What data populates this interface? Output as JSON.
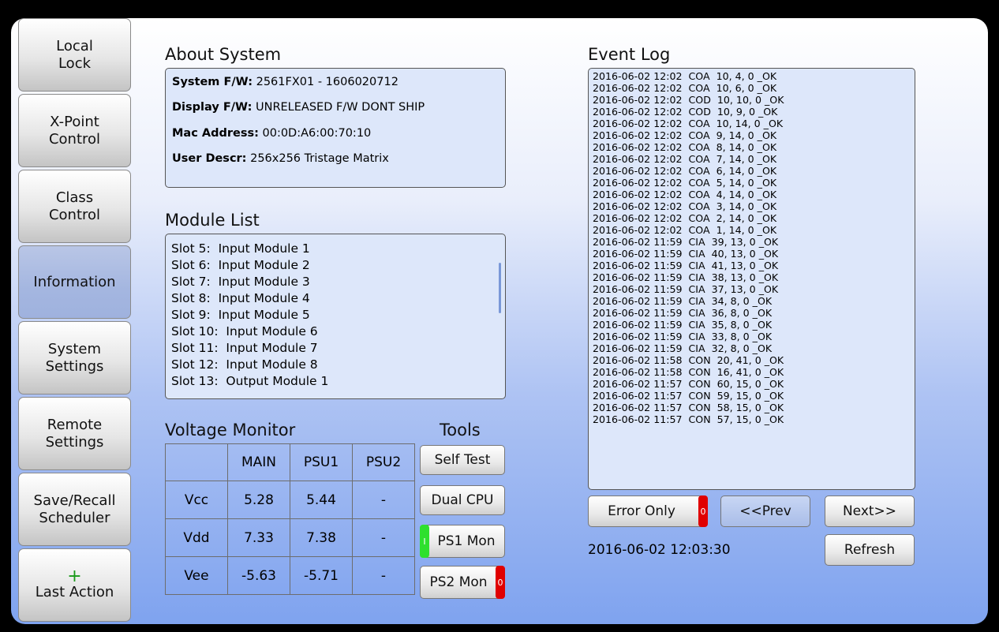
{
  "sidebar": {
    "items": [
      {
        "label": "Local\nLock"
      },
      {
        "label": "X-Point\nControl"
      },
      {
        "label": "Class\nControl"
      },
      {
        "label": "Information"
      },
      {
        "label": "System\nSettings"
      },
      {
        "label": "Remote\nSettings"
      },
      {
        "label": "Save/Recall\nScheduler"
      },
      {
        "label": "Last Action",
        "icon": "plus-icon",
        "glyph": "+"
      }
    ],
    "active": "Information"
  },
  "about": {
    "title": "About System",
    "system_fw_label": "System F/W:",
    "system_fw": "2561FX01 - 1606020712",
    "display_fw_label": "Display F/W:",
    "display_fw": "UNRELEASED F/W DONT SHIP",
    "mac_label": "Mac Address:",
    "mac": "00:0D:A6:00:70:10",
    "user_descr_label": "User Descr:",
    "user_descr": "256x256 Tristage Matrix"
  },
  "modules": {
    "title": "Module List",
    "items": [
      "Slot 5:  Input Module 1",
      "Slot 6:  Input Module 2",
      "Slot 7:  Input Module 3",
      "Slot 8:  Input Module 4",
      "Slot 9:  Input Module 5",
      "Slot 10:  Input Module 6",
      "Slot 11:  Input Module 7",
      "Slot 12:  Input Module 8",
      "Slot 13:  Output Module 1"
    ]
  },
  "voltage": {
    "title": "Voltage Monitor",
    "headers": [
      "",
      "MAIN",
      "PSU1",
      "PSU2"
    ],
    "rows": [
      [
        "Vcc",
        "5.28",
        "5.44",
        "-"
      ],
      [
        "Vdd",
        "7.33",
        "7.38",
        "-"
      ],
      [
        "Vee",
        "-5.63",
        "-5.71",
        "-"
      ]
    ]
  },
  "tools": {
    "title": "Tools",
    "self_test": "Self Test",
    "dual_cpu": "Dual CPU",
    "ps1_mon": "PS1 Mon",
    "ps1_indicator": "I",
    "ps2_mon": "PS2 Mon",
    "ps2_indicator": "0"
  },
  "event_log": {
    "title": "Event Log",
    "entries": [
      "2016-06-02 12:02  COA  10, 4, 0 _OK",
      "2016-06-02 12:02  COA  10, 6, 0 _OK",
      "2016-06-02 12:02  COD  10, 10, 0 _OK",
      "2016-06-02 12:02  COD  10, 9, 0 _OK",
      "2016-06-02 12:02  COA  10, 14, 0 _OK",
      "2016-06-02 12:02  COA  9, 14, 0 _OK",
      "2016-06-02 12:02  COA  8, 14, 0 _OK",
      "2016-06-02 12:02  COA  7, 14, 0 _OK",
      "2016-06-02 12:02  COA  6, 14, 0 _OK",
      "2016-06-02 12:02  COA  5, 14, 0 _OK",
      "2016-06-02 12:02  COA  4, 14, 0 _OK",
      "2016-06-02 12:02  COA  3, 14, 0 _OK",
      "2016-06-02 12:02  COA  2, 14, 0 _OK",
      "2016-06-02 12:02  COA  1, 14, 0 _OK",
      "2016-06-02 11:59  CIA  39, 13, 0 _OK",
      "2016-06-02 11:59  CIA  40, 13, 0 _OK",
      "2016-06-02 11:59  CIA  41, 13, 0 _OK",
      "2016-06-02 11:59  CIA  38, 13, 0 _OK",
      "2016-06-02 11:59  CIA  37, 13, 0 _OK",
      "2016-06-02 11:59  CIA  34, 8, 0 _OK",
      "2016-06-02 11:59  CIA  36, 8, 0 _OK",
      "2016-06-02 11:59  CIA  35, 8, 0 _OK",
      "2016-06-02 11:59  CIA  33, 8, 0 _OK",
      "2016-06-02 11:59  CIA  32, 8, 0 _OK",
      "2016-06-02 11:58  CON  20, 41, 0 _OK",
      "2016-06-02 11:58  CON  16, 41, 0 _OK",
      "2016-06-02 11:57  CON  60, 15, 0 _OK",
      "2016-06-02 11:57  CON  59, 15, 0 _OK",
      "2016-06-02 11:57  CON  58, 15, 0 _OK",
      "2016-06-02 11:57  CON  57, 15, 0 _OK"
    ],
    "error_only": "Error Only",
    "error_indicator": "0",
    "prev": "<<Prev",
    "next": "Next>>",
    "refresh": "Refresh",
    "timestamp": "2016-06-02 12:03:30"
  },
  "colors": {
    "active_nav": "#a4b6e0",
    "panel_bg": "#dde7fa",
    "led_red": "#e00000",
    "led_green": "#2ee02e"
  }
}
